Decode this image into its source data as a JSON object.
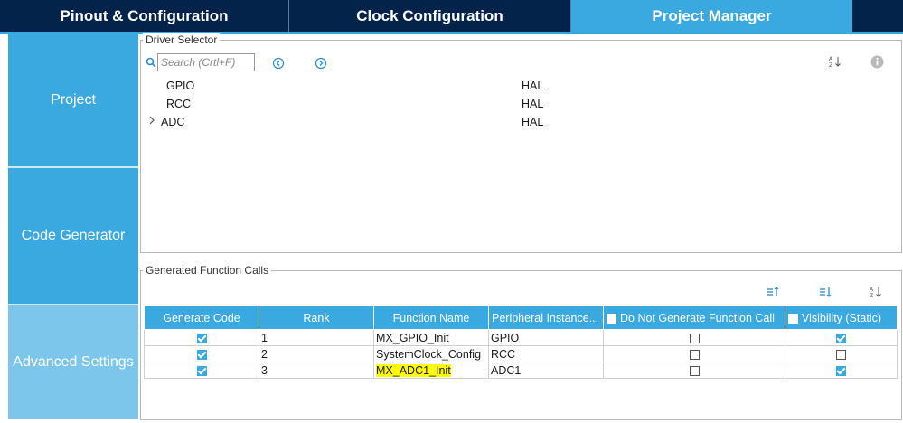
{
  "tabs": [
    {
      "label": "Pinout & Configuration",
      "active": false
    },
    {
      "label": "Clock Configuration",
      "active": false
    },
    {
      "label": "Project Manager",
      "active": true
    }
  ],
  "sidebar": {
    "items": [
      {
        "label": "Project"
      },
      {
        "label": "Code Generator"
      },
      {
        "label": "Advanced Settings"
      }
    ]
  },
  "driver_selector": {
    "title": "Driver Selector",
    "search_placeholder": "Search (Crtl+F)",
    "rows": [
      {
        "name": "GPIO",
        "value": "HAL"
      },
      {
        "name": "RCC",
        "value": "HAL"
      },
      {
        "name": "ADC",
        "value": "HAL",
        "expandable": true
      }
    ]
  },
  "generated_calls": {
    "title": "Generated Function Calls",
    "columns": [
      "Generate Code",
      "Rank",
      "Function Name",
      "Peripheral Instance...",
      "Do Not Generate Function Call",
      "Visibility (Static)"
    ],
    "rows": [
      {
        "generate": true,
        "rank": "1",
        "function": "MX_GPIO_Init",
        "peripheral": "GPIO",
        "no_call": false,
        "static": true
      },
      {
        "generate": true,
        "rank": "2",
        "function": "SystemClock_Config",
        "peripheral": "RCC",
        "no_call": false,
        "static": false
      },
      {
        "generate": true,
        "rank": "3",
        "function": "MX_ADC1_Init",
        "peripheral": "ADC1",
        "no_call": false,
        "static": true,
        "highlighted": true
      }
    ]
  },
  "colors": {
    "accent": "#3aa9e0",
    "tabbar_bg": "#03234b",
    "sidebar_light": "#7cc6ec",
    "highlight": "#ffff00"
  }
}
